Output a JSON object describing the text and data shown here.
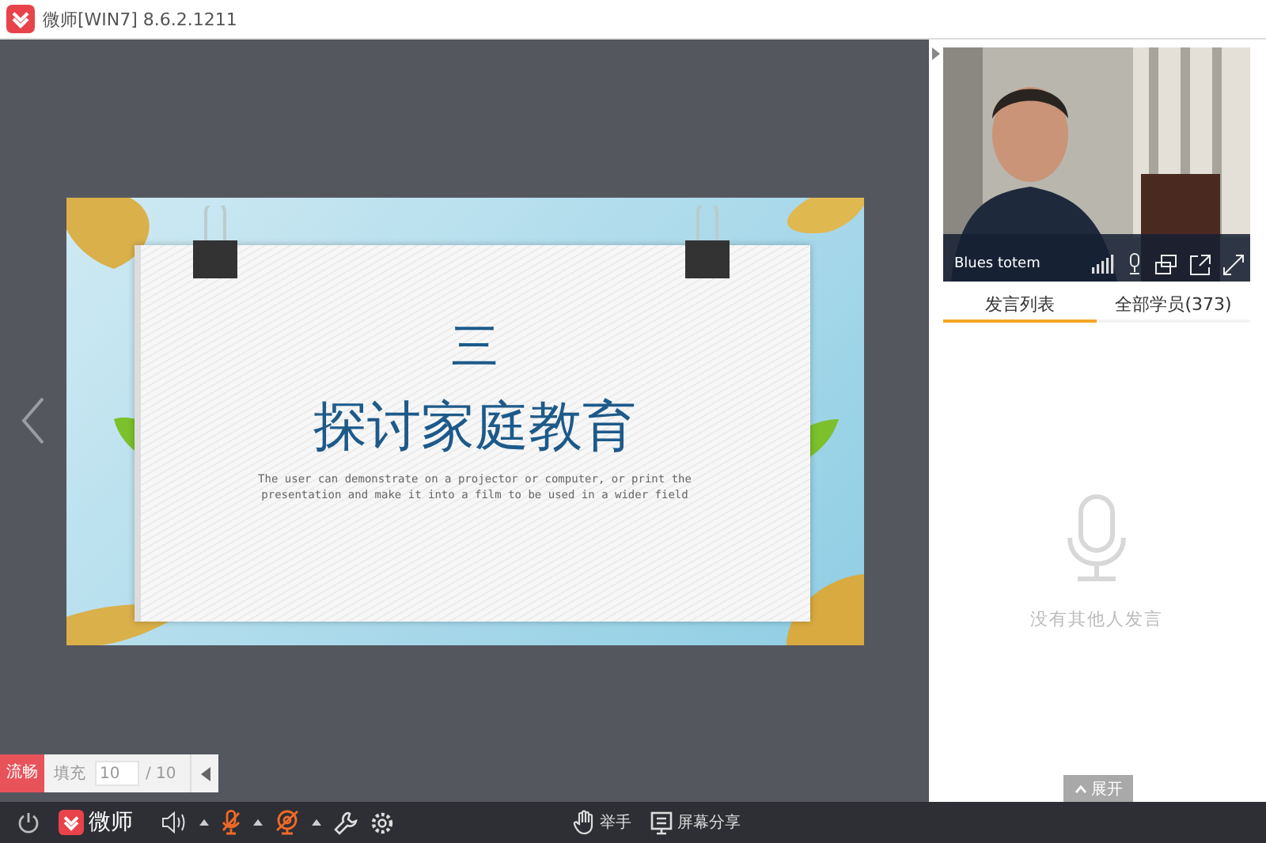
{
  "window": {
    "title": "微师[WIN7] 8.6.2.1211"
  },
  "slide": {
    "number": "三",
    "title": "探讨家庭教育",
    "body": "The user can demonstrate on a projector or computer, or print the presentation and make it into a film to be used in a wider field"
  },
  "page_controls": {
    "quality": "流畅",
    "fill_label": "填充",
    "page_input": "10",
    "page_total": "/ 10"
  },
  "video": {
    "name": "Blues totem"
  },
  "panel": {
    "tabs": [
      {
        "label": "发言列表",
        "selected": true
      },
      {
        "label": "全部学员(373)",
        "selected": false
      }
    ],
    "empty_message": "没有其他人发言",
    "expand_button": "展开"
  },
  "toolbar": {
    "brand": "微师",
    "mic_muted": true,
    "camera_off": true,
    "buttons": [
      {
        "label": "举手",
        "kind": "hand"
      },
      {
        "label": "屏幕分享",
        "kind": "screen"
      }
    ]
  }
}
